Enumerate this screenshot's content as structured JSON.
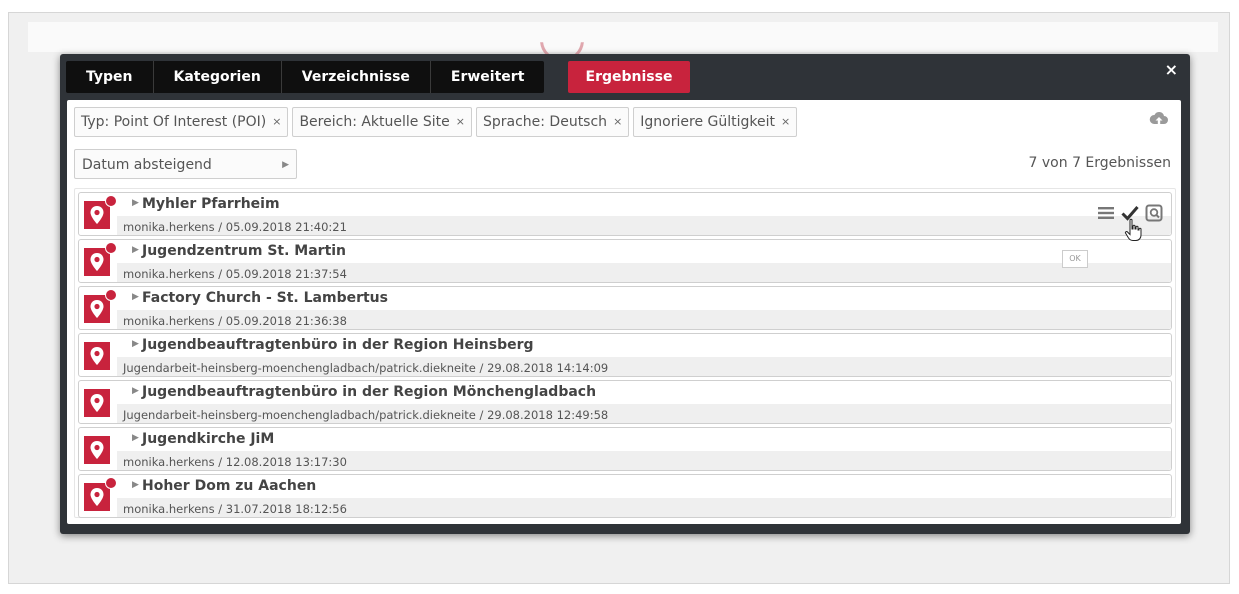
{
  "tabs": [
    {
      "label": "Typen"
    },
    {
      "label": "Kategorien"
    },
    {
      "label": "Verzeichnisse"
    },
    {
      "label": "Erweitert"
    }
  ],
  "active_tab": {
    "label": "Ergebnisse"
  },
  "close_label": "×",
  "filters": [
    {
      "label": "Typ: Point Of Interest (POI)",
      "remove": "×"
    },
    {
      "label": "Bereich: Aktuelle Site",
      "remove": "×"
    },
    {
      "label": "Sprache: Deutsch",
      "remove": "×"
    },
    {
      "label": "Ignoriere Gültigkeit",
      "remove": "×"
    }
  ],
  "sort": {
    "value": "Datum absteigend",
    "arrow": "▶"
  },
  "result_count": "7 von 7 Ergebnissen",
  "results": [
    {
      "title": "Myhler Pfarrheim",
      "meta": "monika.herkens / 05.09.2018 21:40:21",
      "changed": true
    },
    {
      "title": "Jugendzentrum St. Martin",
      "meta": "monika.herkens / 05.09.2018 21:37:54",
      "changed": true
    },
    {
      "title": "Factory Church - St. Lambertus",
      "meta": "monika.herkens / 05.09.2018 21:36:38",
      "changed": true
    },
    {
      "title": "Jugendbeauftragtenbüro in der Region Heinsberg",
      "meta": "Jugendarbeit-heinsberg-moenchengladbach/patrick.diekneite / 29.08.2018 14:14:09",
      "changed": false
    },
    {
      "title": "Jugendbeauftragtenbüro in der Region Mönchengladbach",
      "meta": "Jugendarbeit-heinsberg-moenchengladbach/patrick.diekneite / 29.08.2018 12:49:58",
      "changed": false
    },
    {
      "title": "Jugendkirche JiM",
      "meta": "monika.herkens / 12.08.2018 13:17:30",
      "changed": false
    },
    {
      "title": "Hoher Dom zu Aachen",
      "meta": "monika.herkens / 31.07.2018 18:12:56",
      "changed": true
    }
  ],
  "item_caret": "▶",
  "tooltip": "OK",
  "colors": {
    "accent": "#c8233d",
    "dialog_bg": "#2f3338",
    "tab_bg": "#0f0f0f"
  },
  "icons": [
    "cloud-upload-icon",
    "map-pin-icon",
    "menu-icon",
    "check-icon",
    "preview-icon",
    "hand-cursor-icon"
  ]
}
